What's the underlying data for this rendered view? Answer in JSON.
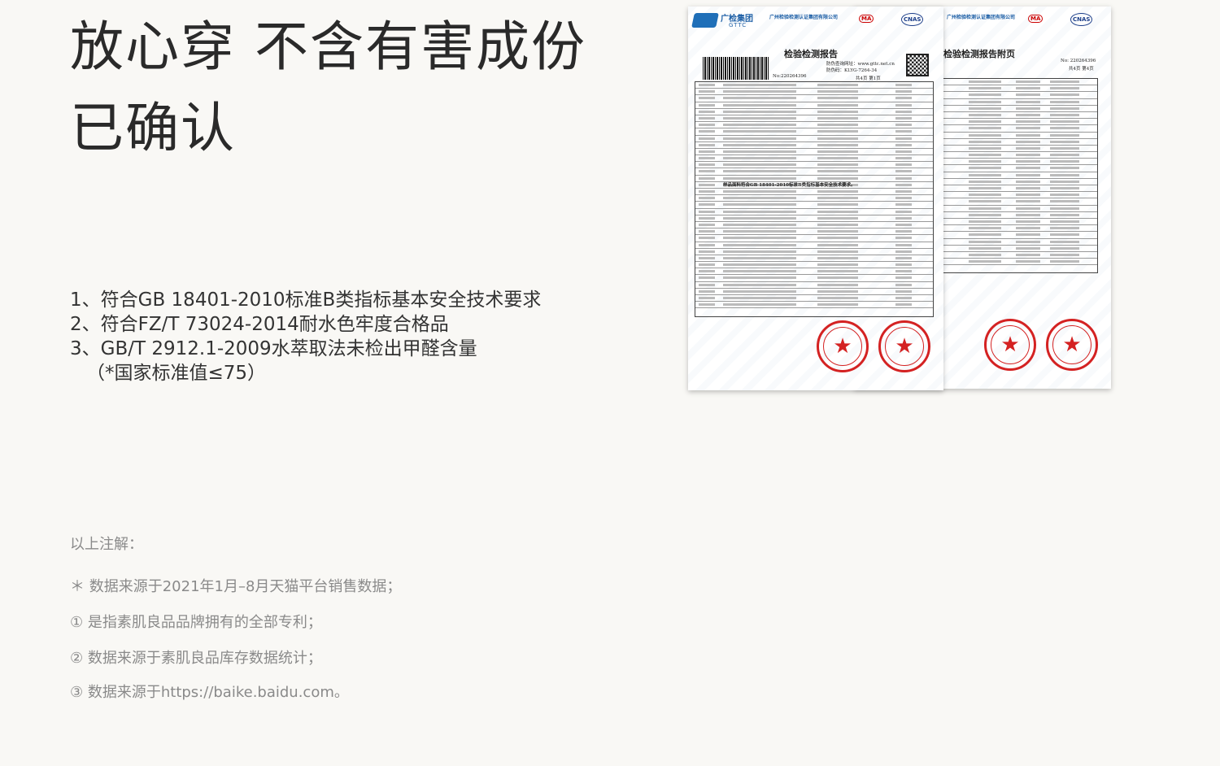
{
  "headline": {
    "line1": "放心穿 不含有害成份",
    "line2": "已确认"
  },
  "features": [
    "1、符合GB 18401-2010标准B类指标基本安全技术要求",
    "2、符合FZ/T 73024-2014耐水色牢度合格品",
    "3、GB/T 2912.1-2009水萃取法未检出甲醛含量",
    "（*国家标准值≤75）"
  ],
  "notes": {
    "heading": "以上注解：",
    "items": [
      "＊  数据来源于2021年1月–8月天猫平台销售数据；",
      "①  是指素肌良品品牌拥有的全部专利；",
      "②  数据来源于素肌良品库存数据统计；",
      "③  数据来源于https://baike.baidu.com。"
    ]
  },
  "report": {
    "brand": "广检集团",
    "brand_en": "GTTC",
    "company": "广州检验检测认证集团有限公司",
    "cert1": "MA",
    "cert2": "CNAS",
    "title": "检验检测报告",
    "number": "No:220264396",
    "verify_url": "防伪查询网址：www.gttc.net.cn",
    "verify_code": "防伪码：KLYG-7264-34",
    "page": "共4页 第1页",
    "conclusion": "样品面料符合GB 18401-2010标准B类指标基本安全技术要求。",
    "appendix_title": "检验检测报告附页",
    "appendix_number": "No: 220264396",
    "appendix_page": "共4页 第4页",
    "stamp_symbol": "★"
  }
}
